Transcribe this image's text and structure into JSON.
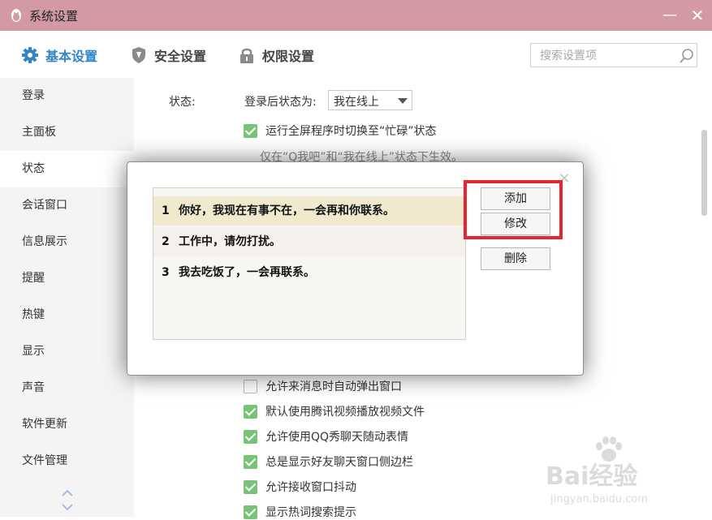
{
  "window": {
    "title": "系统设置",
    "minimize_label": "—",
    "close_label": "✕"
  },
  "tabs": [
    {
      "label": "基本设置",
      "icon": "gear-icon",
      "active": true
    },
    {
      "label": "安全设置",
      "icon": "shield-icon",
      "active": false
    },
    {
      "label": "权限设置",
      "icon": "lock-icon",
      "active": false
    }
  ],
  "search": {
    "placeholder": "搜索设置项",
    "value": ""
  },
  "sidebar": {
    "items": [
      {
        "label": "登录"
      },
      {
        "label": "主面板"
      },
      {
        "label": "状态",
        "active": true
      },
      {
        "label": "会话窗口"
      },
      {
        "label": "信息展示"
      },
      {
        "label": "提醒"
      },
      {
        "label": "热键"
      },
      {
        "label": "显示"
      },
      {
        "label": "声音"
      },
      {
        "label": "软件更新"
      },
      {
        "label": "文件管理"
      }
    ]
  },
  "status": {
    "section_label": "状态:",
    "after_login_label": "登录后状态为:",
    "selected": "我在线上",
    "fullscreen_option": "运行全屏程序时切换至“忙碌”状态",
    "hint": "仅在“Q我吧”和“我在线上”状态下生效。"
  },
  "options": [
    {
      "label": "允许来消息时自动弹出窗口",
      "checked": false
    },
    {
      "label": "默认使用腾讯视频播放视频文件",
      "checked": true
    },
    {
      "label": "允许使用QQ秀聊天随动表情",
      "checked": true
    },
    {
      "label": "总是显示好友聊天窗口侧边栏",
      "checked": true
    },
    {
      "label": "允许接收窗口抖动",
      "checked": true
    },
    {
      "label": "显示热词搜索提示",
      "checked": true
    }
  ],
  "dialog": {
    "close_label": "×",
    "messages": [
      {
        "num": "1",
        "text": "你好，我现在有事不在，一会再和你联系。"
      },
      {
        "num": "2",
        "text": "工作中，请勿打扰。"
      },
      {
        "num": "3",
        "text": "我去吃饭了，一会再联系。"
      }
    ],
    "buttons": {
      "add": "添加",
      "edit": "修改",
      "delete": "删除"
    }
  },
  "colors": {
    "accent": "#2f85c8",
    "titlebar": "#d39aa6",
    "check": "#77c477",
    "highlight": "#e8242e"
  },
  "watermark": {
    "text": "Bai经验",
    "url": "jingyan.baidu.com"
  }
}
